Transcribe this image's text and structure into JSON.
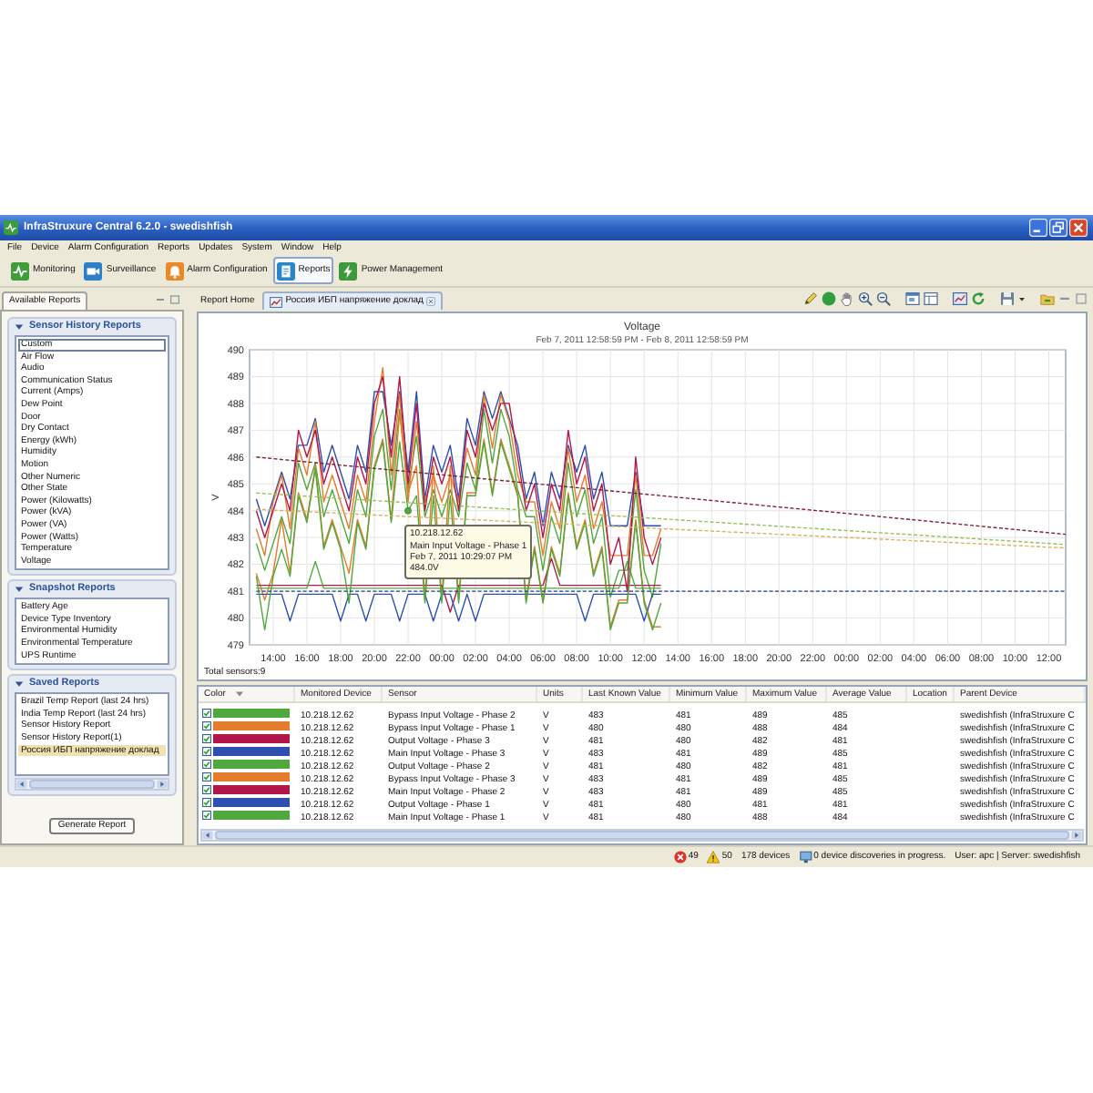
{
  "window": {
    "title": "InfraStruxure Central 6.2.0 - swedishfish"
  },
  "menu": [
    "File",
    "Device",
    "Alarm Configuration",
    "Reports",
    "Updates",
    "System",
    "Window",
    "Help"
  ],
  "toolbar": [
    {
      "label": "Monitoring",
      "selected": false
    },
    {
      "label": "Surveillance",
      "selected": false
    },
    {
      "label": "Alarm Configuration",
      "selected": false
    },
    {
      "label": "Reports",
      "selected": true
    },
    {
      "label": "Power Management",
      "selected": false
    }
  ],
  "left_panel": {
    "tab": "Available Reports",
    "sections": [
      {
        "title": "Sensor History Reports",
        "expanded": true,
        "items": [
          {
            "label": "Custom",
            "focused": true
          },
          {
            "label": "Air Flow",
            "focused": false
          },
          {
            "label": "Audio",
            "focused": false
          },
          {
            "label": "Communication Status",
            "focused": false
          },
          {
            "label": "Current (Amps)",
            "focused": false
          },
          {
            "label": "Dew Point",
            "focused": false
          },
          {
            "label": "Door",
            "focused": false
          },
          {
            "label": "Dry Contact",
            "focused": false
          },
          {
            "label": "Energy (kWh)",
            "focused": false
          },
          {
            "label": "Humidity",
            "focused": false
          },
          {
            "label": "Motion",
            "focused": false
          },
          {
            "label": "Other Numeric",
            "focused": false
          },
          {
            "label": "Other State",
            "focused": false
          },
          {
            "label": "Power (Kilowatts)",
            "focused": false
          },
          {
            "label": "Power (kVA)",
            "focused": false
          },
          {
            "label": "Power (VA)",
            "focused": false
          },
          {
            "label": "Power (Watts)",
            "focused": false
          },
          {
            "label": "Temperature",
            "focused": false
          },
          {
            "label": "Voltage",
            "focused": false
          }
        ]
      },
      {
        "title": "Snapshot Reports",
        "expanded": true,
        "items": [
          {
            "label": "Battery Age"
          },
          {
            "label": "Device Type Inventory"
          },
          {
            "label": "Environmental Humidity"
          },
          {
            "label": "Environmental Temperature"
          },
          {
            "label": "UPS Runtime"
          }
        ]
      },
      {
        "title": "Saved Reports",
        "expanded": true,
        "items": [
          {
            "label": "Brazil Temp Report (last 24 hrs)",
            "selected": false
          },
          {
            "label": "India Temp Report (last 24 hrs)",
            "selected": false
          },
          {
            "label": "Sensor History Report",
            "selected": false
          },
          {
            "label": "Sensor History Report(1)",
            "selected": false
          },
          {
            "label": "Россия ИБП напряжение доклад",
            "selected": true
          }
        ]
      }
    ],
    "button": "Generate Report"
  },
  "report_tabs": [
    {
      "label": "Report Home",
      "kind": "home",
      "selected": false
    },
    {
      "label": "Россия ИБП напряжение доклад",
      "kind": "report",
      "selected": true
    }
  ],
  "chart": {
    "subtitle": "Feb 7, 2011 12:58:59 PM - Feb 8, 2011 12:58:59 PM",
    "footer": "Total sensors:9",
    "chart_data": {
      "type": "line",
      "title": "Voltage",
      "ylabel": "V",
      "grid": true,
      "categories": [
        null,
        null,
        "14:00",
        null,
        null,
        null,
        "16:00",
        null,
        null,
        null,
        "18:00",
        null,
        null,
        null,
        "20:00",
        null,
        null,
        null,
        "22:00",
        null,
        null,
        null,
        "00:00",
        null,
        null,
        null,
        "02:00",
        null,
        null,
        null,
        "04:00",
        null,
        null,
        null,
        "06:00",
        null,
        null,
        null,
        "08:00",
        null,
        null,
        null,
        "10:00",
        null,
        null,
        null,
        "12:00",
        null,
        null,
        null,
        "14:00",
        null,
        null,
        null,
        "16:00",
        null,
        null,
        null,
        "18:00",
        null,
        null,
        null,
        "20:00",
        null,
        null,
        null,
        "22:00",
        null,
        null,
        null,
        "00:00",
        null,
        null,
        null,
        "02:00",
        null,
        null,
        null,
        "04:00",
        null,
        null,
        null,
        "06:00",
        null,
        null,
        null,
        "08:00",
        null,
        null,
        null,
        "10:00",
        null,
        null,
        null,
        "12:00",
        null,
        null
      ],
      "ylim": [
        479,
        490
      ],
      "yticks": [
        {
          "value": 479,
          "label": "479"
        },
        {
          "value": 480,
          "label": "480"
        },
        {
          "value": 481,
          "label": "481"
        },
        {
          "value": 482,
          "label": "482"
        },
        {
          "value": 483,
          "label": "483"
        },
        {
          "value": 484,
          "label": "484"
        },
        {
          "value": 485,
          "label": "485"
        },
        {
          "value": 486,
          "label": "486"
        },
        {
          "value": 487,
          "label": "487"
        },
        {
          "value": 488,
          "label": "488"
        },
        {
          "value": 489,
          "label": "489"
        },
        {
          "value": 490,
          "label": "490"
        }
      ],
      "series": [
        {
          "color": "#4fa83d",
          "values": [
            482.78,
            481.78,
            482.78,
            483.78,
            482.78,
            485.78,
            484.78,
            485.78,
            483.78,
            484.78,
            483.78,
            482.78,
            484.78,
            483.78,
            486.78,
            487.78,
            484.78,
            487.78,
            484.78,
            486.78,
            483.78,
            484.78,
            483.78,
            484.78,
            483.78,
            485.78,
            484.78,
            487.78,
            485.78,
            487.78,
            486.78,
            484.78,
            483.78,
            483.78,
            481.78,
            483.78,
            482.78,
            485.78,
            483.78,
            484.78,
            482.78,
            483.78,
            480.78,
            481.78,
            481.78,
            484.78,
            481.78,
            480.78,
            482.78,
            null,
            null,
            null,
            null,
            null,
            null,
            null,
            null,
            null,
            null,
            null,
            null,
            null,
            null,
            null,
            null,
            null,
            null,
            null,
            null,
            null,
            null,
            null,
            null,
            null,
            null,
            null,
            null,
            null,
            null,
            null,
            null,
            null,
            null,
            null,
            null,
            null,
            null,
            null,
            null,
            null,
            null,
            null,
            null,
            null,
            null,
            null,
            null
          ]
        },
        {
          "color": "#e37d2b",
          "values": [
            481.67,
            480.67,
            481.67,
            483.67,
            481.67,
            484.67,
            483.67,
            485.67,
            482.67,
            483.67,
            482.67,
            481.67,
            483.67,
            482.67,
            485.67,
            486.67,
            483.67,
            487.67,
            484.67,
            485.67,
            480.67,
            485.67,
            480.67,
            485.67,
            480.67,
            484.67,
            484.67,
            486.67,
            484.67,
            486.67,
            485.67,
            484.67,
            480.67,
            482.67,
            480.67,
            482.67,
            481.67,
            484.67,
            482.67,
            483.67,
            481.67,
            482.67,
            479.67,
            480.67,
            480.67,
            483.67,
            480.67,
            479.67,
            479.67,
            null,
            null,
            null,
            null,
            null,
            null,
            null,
            null,
            null,
            null,
            null,
            null,
            null,
            null,
            null,
            null,
            null,
            null,
            null,
            null,
            null,
            null,
            null,
            null,
            null,
            null,
            null,
            null,
            null,
            null,
            null,
            null,
            null,
            null,
            null,
            null,
            null,
            null,
            null,
            null,
            null,
            null,
            null,
            null,
            null,
            null,
            null,
            null
          ]
        },
        {
          "color": "#b3164b",
          "values": [
            481.22,
            481.22,
            481.22,
            481.22,
            481.22,
            481.22,
            481.22,
            481.22,
            481.22,
            481.22,
            481.22,
            481.22,
            481.22,
            481.22,
            481.22,
            481.22,
            481.22,
            481.22,
            481.22,
            481.22,
            481.22,
            481.22,
            481.22,
            480.22,
            481.22,
            481.22,
            481.22,
            481.22,
            481.22,
            481.22,
            481.22,
            481.22,
            481.22,
            481.22,
            481.22,
            482.22,
            481.22,
            481.22,
            481.22,
            481.22,
            481.22,
            481.22,
            481.22,
            481.22,
            481.22,
            481.22,
            481.22,
            481.22,
            481.22,
            null,
            null,
            null,
            null,
            null,
            null,
            null,
            null,
            null,
            null,
            null,
            null,
            null,
            null,
            null,
            null,
            null,
            null,
            null,
            null,
            null,
            null,
            null,
            null,
            null,
            null,
            null,
            null,
            null,
            null,
            null,
            null,
            null,
            null,
            null,
            null,
            null,
            null,
            null,
            null,
            null,
            null,
            null,
            null,
            null,
            null,
            null,
            null
          ]
        },
        {
          "color": "#2c4fb0",
          "values": [
            484.44,
            483.44,
            484.44,
            485.44,
            484.44,
            486.44,
            486.44,
            487.44,
            485.44,
            486.44,
            485.44,
            484.44,
            486.44,
            485.44,
            488.44,
            488.44,
            486.44,
            488.44,
            485.44,
            488.44,
            484.44,
            486.44,
            485.44,
            486.44,
            484.44,
            487.44,
            486.44,
            488.44,
            487.44,
            488.44,
            487.44,
            486.44,
            484.44,
            485.44,
            483.44,
            485.44,
            484.44,
            486.44,
            485.44,
            486.44,
            484.44,
            485.44,
            483.44,
            483.44,
            483.44,
            485.44,
            483.44,
            483.44,
            483.44,
            null,
            null,
            null,
            null,
            null,
            null,
            null,
            null,
            null,
            null,
            null,
            null,
            null,
            null,
            null,
            null,
            null,
            null,
            null,
            null,
            null,
            null,
            null,
            null,
            null,
            null,
            null,
            null,
            null,
            null,
            null,
            null,
            null,
            null,
            null,
            null,
            null,
            null,
            null,
            null,
            null,
            null,
            null,
            null,
            null,
            null,
            null,
            null
          ]
        },
        {
          "color": "#4fa83d",
          "values": [
            481.11,
            481.11,
            481.11,
            481.11,
            481.11,
            481.11,
            481.11,
            482.11,
            481.11,
            481.11,
            481.11,
            481.11,
            481.11,
            481.11,
            481.11,
            481.11,
            481.11,
            481.11,
            481.11,
            481.11,
            481.11,
            481.11,
            481.11,
            481.11,
            481.11,
            481.11,
            481.11,
            481.11,
            481.11,
            481.11,
            481.11,
            481.11,
            481.11,
            481.11,
            481.11,
            481.11,
            481.11,
            481.11,
            481.11,
            481.11,
            481.11,
            481.11,
            481.11,
            481.11,
            482.11,
            481.11,
            481.11,
            481.11,
            481.11,
            null,
            null,
            null,
            null,
            null,
            null,
            null,
            null,
            null,
            null,
            null,
            null,
            null,
            null,
            null,
            null,
            null,
            null,
            null,
            null,
            null,
            null,
            null,
            null,
            null,
            null,
            null,
            null,
            null,
            null,
            null,
            null,
            null,
            null,
            null,
            null,
            null,
            null,
            null,
            null,
            null,
            null,
            null,
            null,
            null,
            null,
            null,
            null
          ]
        },
        {
          "color": "#e37d2b",
          "values": [
            483.33,
            482.33,
            484.33,
            485.33,
            483.33,
            486.33,
            485.33,
            487.33,
            484.33,
            485.33,
            484.33,
            483.33,
            485.33,
            484.33,
            487.33,
            489.33,
            485.33,
            488.33,
            484.33,
            487.33,
            484.33,
            485.33,
            484.33,
            485.33,
            484.33,
            486.33,
            485.33,
            488.33,
            486.33,
            488.33,
            487.33,
            485.33,
            484.33,
            484.33,
            482.33,
            484.33,
            483.33,
            486.33,
            484.33,
            485.33,
            483.33,
            484.33,
            482.33,
            482.33,
            482.33,
            485.33,
            482.33,
            482.33,
            483.33,
            null,
            null,
            null,
            null,
            null,
            null,
            null,
            null,
            null,
            null,
            null,
            null,
            null,
            null,
            null,
            null,
            null,
            null,
            null,
            null,
            null,
            null,
            null,
            null,
            null,
            null,
            null,
            null,
            null,
            null,
            null,
            null,
            null,
            null,
            null,
            null,
            null,
            null,
            null,
            null,
            null,
            null,
            null,
            null,
            null,
            null,
            null,
            null
          ]
        },
        {
          "color": "#b3164b",
          "values": [
            484,
            483,
            484,
            485,
            484,
            487,
            486,
            487,
            485,
            486,
            485,
            484,
            486,
            485,
            488,
            489,
            486,
            489,
            485,
            488,
            484,
            486,
            485,
            486,
            484,
            487,
            486,
            488,
            487,
            488,
            488,
            486,
            484,
            485,
            483,
            485,
            484,
            487,
            485,
            486,
            484,
            485,
            482,
            483,
            481,
            486,
            483,
            482,
            483,
            null,
            null,
            null,
            null,
            null,
            null,
            null,
            null,
            null,
            null,
            null,
            null,
            null,
            null,
            null,
            null,
            null,
            null,
            null,
            null,
            null,
            null,
            null,
            null,
            null,
            null,
            null,
            null,
            null,
            null,
            null,
            null,
            null,
            null,
            null,
            null,
            null,
            null,
            null,
            null,
            null,
            null,
            null,
            null,
            null,
            null,
            null,
            null
          ]
        },
        {
          "color": "#2c4fb0",
          "values": [
            480.89,
            480.89,
            480.89,
            480.89,
            479.89,
            480.89,
            480.89,
            480.89,
            480.89,
            480.89,
            479.89,
            480.89,
            480.89,
            479.89,
            480.89,
            480.89,
            480.89,
            479.89,
            480.89,
            480.89,
            480.89,
            479.89,
            480.89,
            480.89,
            479.89,
            480.89,
            479.89,
            480.89,
            480.89,
            480.89,
            480.89,
            480.89,
            480.89,
            480.89,
            480.89,
            480.89,
            480.89,
            480.89,
            480.89,
            479.89,
            480.89,
            480.89,
            480.89,
            480.89,
            480.89,
            480.89,
            479.89,
            480.89,
            480.89,
            null,
            null,
            null,
            null,
            null,
            null,
            null,
            null,
            null,
            null,
            null,
            null,
            null,
            null,
            null,
            null,
            null,
            null,
            null,
            null,
            null,
            null,
            null,
            null,
            null,
            null,
            null,
            null,
            null,
            null,
            null,
            null,
            null,
            null,
            null,
            null,
            null,
            null,
            null,
            null,
            null,
            null,
            null,
            null,
            null,
            null,
            null,
            null
          ]
        },
        {
          "color": "#4fa83d",
          "values": [
            481.56,
            479.56,
            481.56,
            482.56,
            481.56,
            484.56,
            483.56,
            485.56,
            482.56,
            483.56,
            482.56,
            480.56,
            483.56,
            482.56,
            485.56,
            486.56,
            483.56,
            486.56,
            484,
            484.56,
            480.56,
            484.56,
            480.56,
            484.56,
            480.56,
            484.56,
            484.56,
            486.56,
            484.56,
            486.56,
            485.56,
            484.56,
            480.56,
            482.56,
            480.56,
            482.56,
            481.56,
            484.56,
            482.56,
            483.56,
            481.56,
            482.56,
            479.56,
            480.56,
            480.56,
            483.56,
            480.56,
            479.56,
            480.56,
            null,
            null,
            null,
            null,
            null,
            null,
            null,
            null,
            null,
            null,
            null,
            null,
            null,
            null,
            null,
            null,
            null,
            null,
            null,
            null,
            null,
            null,
            null,
            null,
            null,
            null,
            null,
            null,
            null,
            null,
            null,
            null,
            null,
            null,
            null,
            null,
            null,
            null,
            null,
            null,
            null,
            null,
            null,
            null,
            null,
            null,
            null,
            null
          ]
        },
        {
          "color": "#7d2531",
          "line_style": "dashed",
          "values": [
            486,
            485.97,
            485.94,
            485.91,
            485.88,
            485.85,
            485.82,
            485.79,
            485.76,
            485.73,
            485.7,
            485.67,
            485.64,
            485.61,
            485.58,
            485.55,
            485.52,
            485.49,
            485.46,
            485.43,
            485.4,
            485.37,
            485.34,
            485.31,
            485.28,
            485.25,
            485.22,
            485.19,
            485.16,
            485.13,
            485.1,
            485.07,
            485.04,
            485.01,
            484.98,
            484.95,
            484.92,
            484.89,
            484.86,
            484.83,
            484.8,
            484.77,
            484.74,
            484.71,
            484.68,
            484.65,
            484.62,
            484.59,
            484.56,
            484.53,
            484.5,
            484.47,
            484.44,
            484.41,
            484.38,
            484.35,
            484.32,
            484.29,
            484.26,
            484.23,
            484.2,
            484.17,
            484.14,
            484.11,
            484.08,
            484.05,
            484.02,
            483.99,
            483.96,
            483.93,
            483.9,
            483.87,
            483.84,
            483.81,
            483.78,
            483.75,
            483.72,
            483.69,
            483.66,
            483.63,
            483.6,
            483.57,
            483.54,
            483.51,
            483.48,
            483.45,
            483.42,
            483.39,
            483.36,
            483.33,
            483.3,
            483.27,
            483.24,
            483.21,
            483.18,
            483.15,
            483.12
          ]
        },
        {
          "color": "#97c257",
          "line_style": "dashed",
          "values": [
            484.66,
            484.64,
            484.62,
            484.6,
            484.58,
            484.56,
            484.54,
            484.52,
            484.5,
            484.48,
            484.46,
            484.44,
            484.42,
            484.4,
            484.38,
            484.36,
            484.34,
            484.32,
            484.3,
            484.28,
            484.26,
            484.24,
            484.22,
            484.2,
            484.18,
            484.16,
            484.14,
            484.12,
            484.1,
            484.08,
            484.06,
            484.04,
            484.02,
            484,
            483.98,
            483.96,
            483.94,
            483.92,
            483.9,
            483.88,
            483.86,
            483.84,
            483.82,
            483.8,
            483.78,
            483.76,
            483.74,
            483.72,
            483.7,
            483.68,
            483.66,
            483.64,
            483.62,
            483.6,
            483.58,
            483.56,
            483.54,
            483.52,
            483.5,
            483.48,
            483.46,
            483.44,
            483.42,
            483.4,
            483.38,
            483.36,
            483.34,
            483.32,
            483.3,
            483.28,
            483.26,
            483.24,
            483.22,
            483.2,
            483.18,
            483.16,
            483.14,
            483.12,
            483.1,
            483.08,
            483.06,
            483.04,
            483.02,
            483,
            482.98,
            482.96,
            482.94,
            482.92,
            482.9,
            482.88,
            482.86,
            482.84,
            482.82,
            482.8,
            482.78,
            482.76,
            482.74
          ]
        },
        {
          "color": "#d6b45c",
          "line_style": "dashed",
          "values": [
            484.05,
            484.04,
            484.02,
            484.01,
            483.99,
            483.98,
            483.96,
            483.95,
            483.93,
            483.92,
            483.9,
            483.89,
            483.87,
            483.86,
            483.84,
            483.83,
            483.81,
            483.8,
            483.78,
            483.77,
            483.75,
            483.74,
            483.72,
            483.71,
            483.69,
            483.68,
            483.66,
            483.65,
            483.63,
            483.62,
            483.6,
            483.59,
            483.57,
            483.56,
            483.54,
            483.53,
            483.51,
            483.5,
            483.48,
            483.47,
            483.45,
            483.44,
            483.42,
            483.41,
            483.39,
            483.38,
            483.36,
            483.35,
            483.33,
            483.32,
            483.3,
            483.29,
            483.27,
            483.26,
            483.24,
            483.23,
            483.21,
            483.2,
            483.18,
            483.17,
            483.15,
            483.14,
            483.12,
            483.11,
            483.09,
            483.08,
            483.06,
            483.05,
            483.03,
            483.02,
            483,
            482.99,
            482.97,
            482.96,
            482.94,
            482.93,
            482.91,
            482.9,
            482.88,
            482.87,
            482.85,
            482.84,
            482.82,
            482.81,
            482.79,
            482.78,
            482.76,
            482.75,
            482.73,
            482.72,
            482.7,
            482.69,
            482.67,
            482.66,
            482.64,
            482.63,
            482.61
          ]
        },
        {
          "color": "#2a3c8c",
          "line_style": "dashed",
          "values": [
            481,
            481,
            481,
            481,
            481,
            481,
            481,
            481,
            481,
            481,
            481,
            481,
            481,
            481,
            481,
            481,
            481,
            481,
            481,
            481,
            481,
            481,
            481,
            481,
            481,
            481,
            481,
            481,
            481,
            481,
            481,
            481,
            481,
            481,
            481,
            481,
            481,
            481,
            481,
            481,
            481,
            481,
            481,
            481,
            481,
            481,
            481,
            481,
            481,
            481,
            481,
            481,
            481,
            481,
            481,
            481,
            481,
            481,
            481,
            481,
            481,
            481,
            481,
            481,
            481,
            481,
            481,
            481,
            481,
            481,
            481,
            481,
            481,
            481,
            481,
            481,
            481,
            481,
            481,
            481,
            481,
            481,
            481,
            481,
            481,
            481,
            481,
            481,
            481,
            481,
            481,
            481,
            481,
            481,
            481,
            481,
            481
          ]
        }
      ],
      "annotations": [
        {
          "x": "22:00",
          "y": 484,
          "text": "10.218.12.62\nMain Input Voltage - Phase 1\nFeb 7, 2011 10:29:07 PM\n484.0V"
        }
      ]
    }
  },
  "table": {
    "columns": [
      "Color",
      "Monitored Device",
      "Sensor",
      "Units",
      "Last Known Value",
      "Minimum Value",
      "Maximum Value",
      "Average Value",
      "Location",
      "Parent Device"
    ],
    "rows": [
      {
        "checked": true,
        "color": "#4fa83d",
        "monitored_device": "10.218.12.62",
        "sensor": "Bypass Input Voltage - Phase 2",
        "units": "V",
        "last_known_value": "483",
        "minimum_value": "481",
        "maximum_value": "489",
        "average_value": "485",
        "parent_device": "swedishfish (InfraStruxure C"
      },
      {
        "checked": true,
        "color": "#e37d2b",
        "monitored_device": "10.218.12.62",
        "sensor": "Bypass Input Voltage - Phase 1",
        "units": "V",
        "last_known_value": "480",
        "minimum_value": "480",
        "maximum_value": "488",
        "average_value": "484",
        "parent_device": "swedishfish (InfraStruxure C"
      },
      {
        "checked": true,
        "color": "#b3164b",
        "monitored_device": "10.218.12.62",
        "sensor": "Output Voltage - Phase 3",
        "units": "V",
        "last_known_value": "481",
        "minimum_value": "480",
        "maximum_value": "482",
        "average_value": "481",
        "parent_device": "swedishfish (InfraStruxure C"
      },
      {
        "checked": true,
        "color": "#2c4fb0",
        "monitored_device": "10.218.12.62",
        "sensor": "Main Input Voltage - Phase 3",
        "units": "V",
        "last_known_value": "483",
        "minimum_value": "481",
        "maximum_value": "489",
        "average_value": "485",
        "parent_device": "swedishfish (InfraStruxure C"
      },
      {
        "checked": true,
        "color": "#4fa83d",
        "monitored_device": "10.218.12.62",
        "sensor": "Output Voltage - Phase 2",
        "units": "V",
        "last_known_value": "481",
        "minimum_value": "480",
        "maximum_value": "482",
        "average_value": "481",
        "parent_device": "swedishfish (InfraStruxure C"
      },
      {
        "checked": true,
        "color": "#e37d2b",
        "monitored_device": "10.218.12.62",
        "sensor": "Bypass Input Voltage - Phase 3",
        "units": "V",
        "last_known_value": "483",
        "minimum_value": "481",
        "maximum_value": "489",
        "average_value": "485",
        "parent_device": "swedishfish (InfraStruxure C"
      },
      {
        "checked": true,
        "color": "#b3164b",
        "monitored_device": "10.218.12.62",
        "sensor": "Main Input Voltage - Phase 2",
        "units": "V",
        "last_known_value": "483",
        "minimum_value": "481",
        "maximum_value": "489",
        "average_value": "485",
        "parent_device": "swedishfish (InfraStruxure C"
      },
      {
        "checked": true,
        "color": "#2c4fb0",
        "monitored_device": "10.218.12.62",
        "sensor": "Output Voltage - Phase 1",
        "units": "V",
        "last_known_value": "481",
        "minimum_value": "480",
        "maximum_value": "481",
        "average_value": "481",
        "parent_device": "swedishfish (InfraStruxure C"
      },
      {
        "checked": true,
        "color": "#4fa83d",
        "monitored_device": "10.218.12.62",
        "sensor": "Main Input Voltage - Phase 1",
        "units": "V",
        "last_known_value": "481",
        "minimum_value": "480",
        "maximum_value": "488",
        "average_value": "484",
        "parent_device": "swedishfish (InfraStruxure C"
      }
    ]
  },
  "status_bar": {
    "errors": "49",
    "warnings": "50",
    "devices": "178 devices",
    "discoveries": "0 device discoveries in progress.",
    "user_server": "User: apc | Server: swedishfish"
  }
}
